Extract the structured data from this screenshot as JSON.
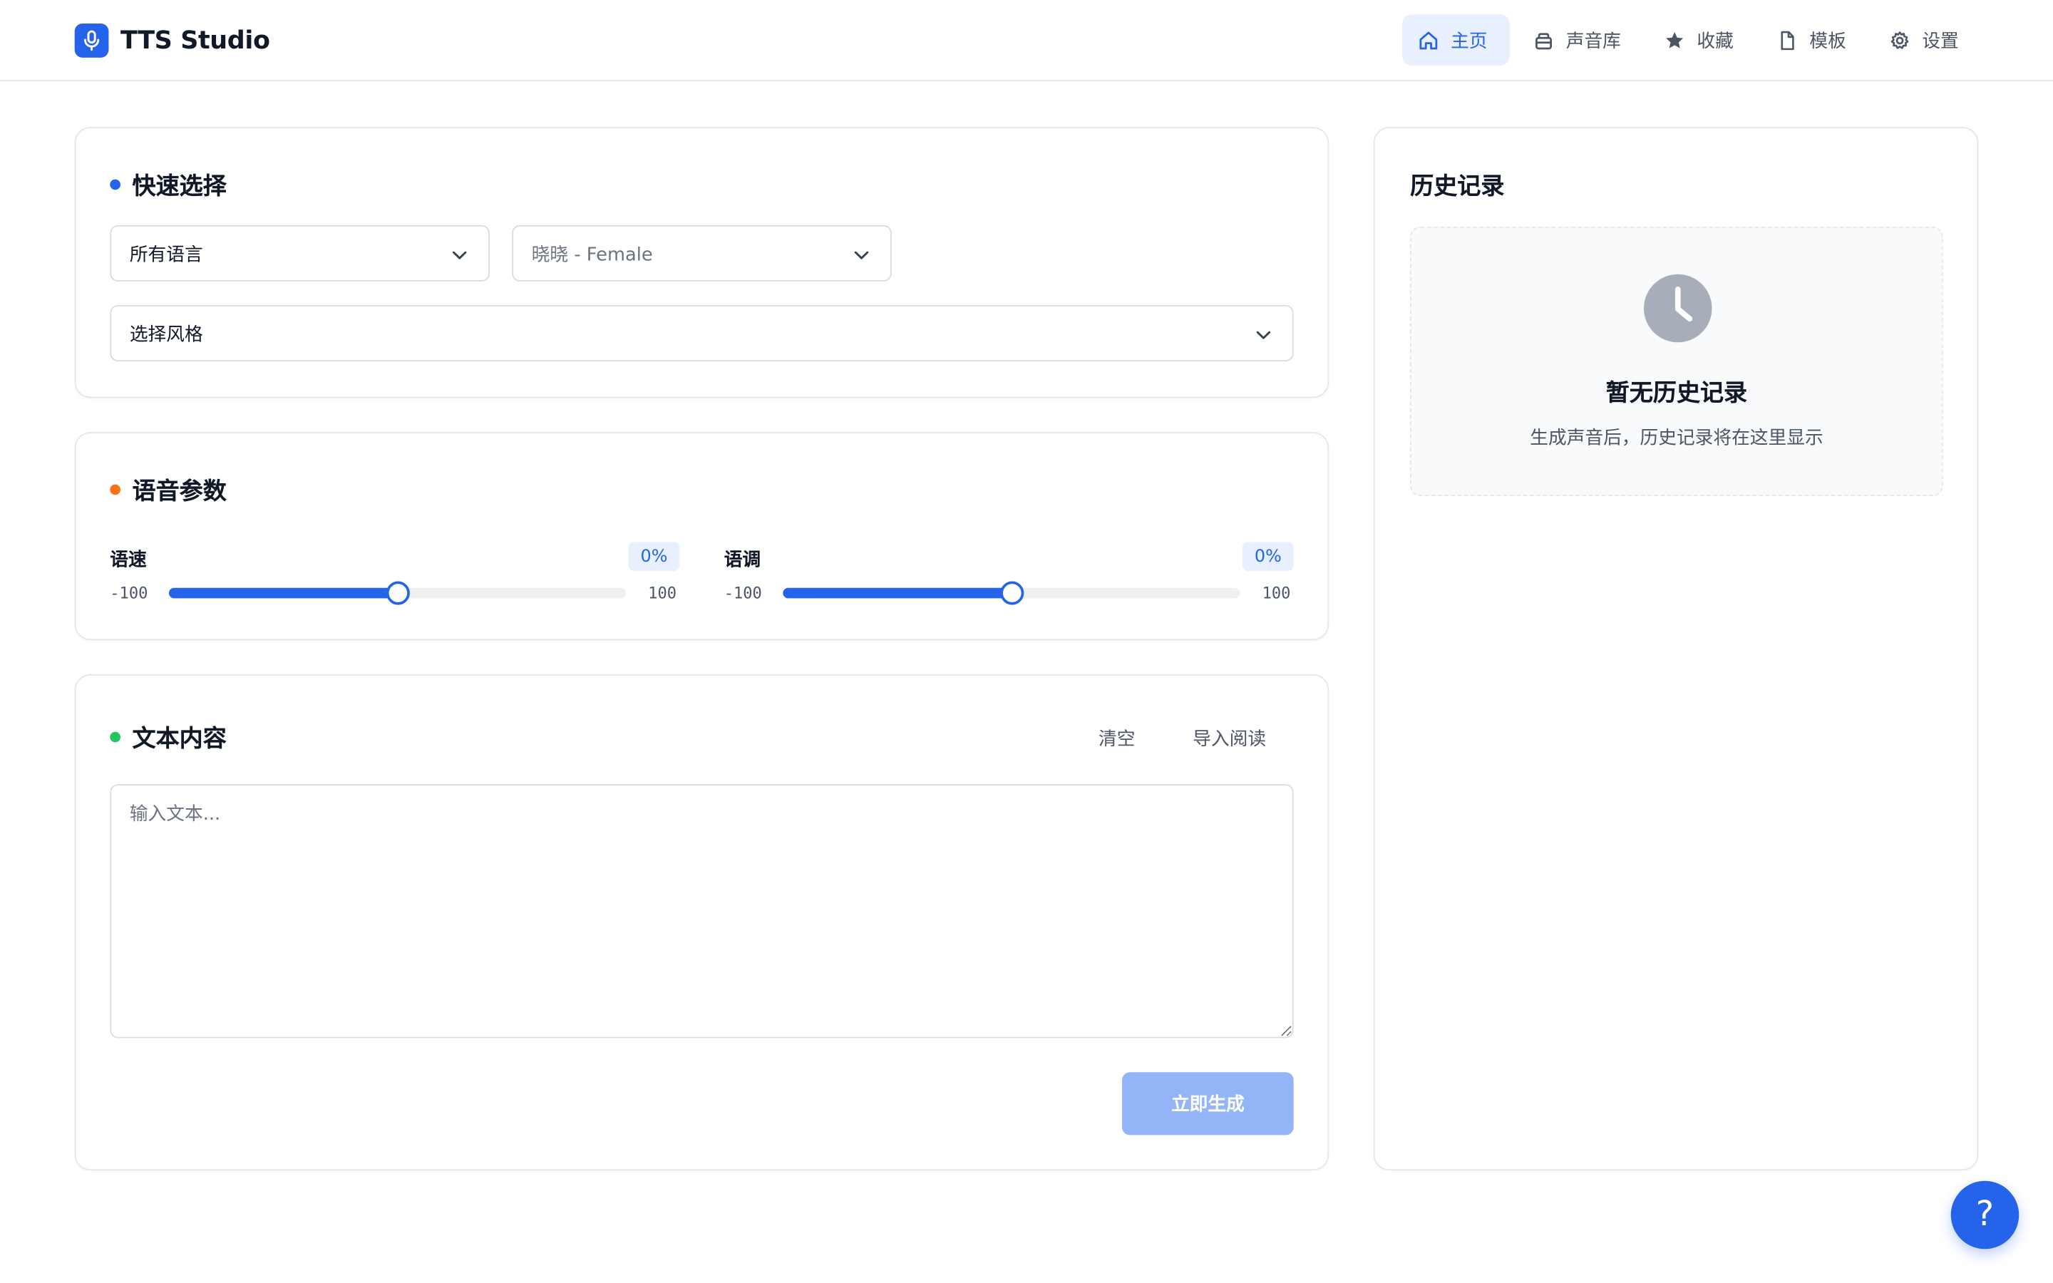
{
  "app": {
    "title": "TTS Studio"
  },
  "nav": {
    "items": [
      {
        "label": "主页",
        "icon": "home-icon",
        "active": true
      },
      {
        "label": "声音库",
        "icon": "library-icon",
        "active": false
      },
      {
        "label": "收藏",
        "icon": "star-icon",
        "active": false
      },
      {
        "label": "模板",
        "icon": "document-icon",
        "active": false
      },
      {
        "label": "设置",
        "icon": "gear-icon",
        "active": false
      }
    ]
  },
  "quick_select": {
    "title": "快速选择",
    "language_value": "所有语言",
    "voice_value": "晓晓 - Female",
    "style_value": "选择风格"
  },
  "voice_params": {
    "title": "语音参数",
    "rate": {
      "label": "语速",
      "percent": "0%",
      "min": "-100",
      "max": "100",
      "value": 0
    },
    "pitch": {
      "label": "语调",
      "percent": "0%",
      "min": "-100",
      "max": "100",
      "value": 0
    }
  },
  "text_content": {
    "title": "文本内容",
    "clear_label": "清空",
    "import_label": "导入阅读",
    "placeholder": "输入文本...",
    "generate_label": "立即生成"
  },
  "history": {
    "title": "历史记录",
    "empty_title": "暂无历史记录",
    "empty_desc": "生成声音后，历史记录将在这里显示"
  },
  "help": {
    "label": "?"
  },
  "colors": {
    "accent": "#2563eb",
    "dot_quick_select": "#2563eb",
    "dot_voice_params": "#f97316",
    "dot_text_content": "#22c55e",
    "generate_disabled": "#93b4f6"
  }
}
